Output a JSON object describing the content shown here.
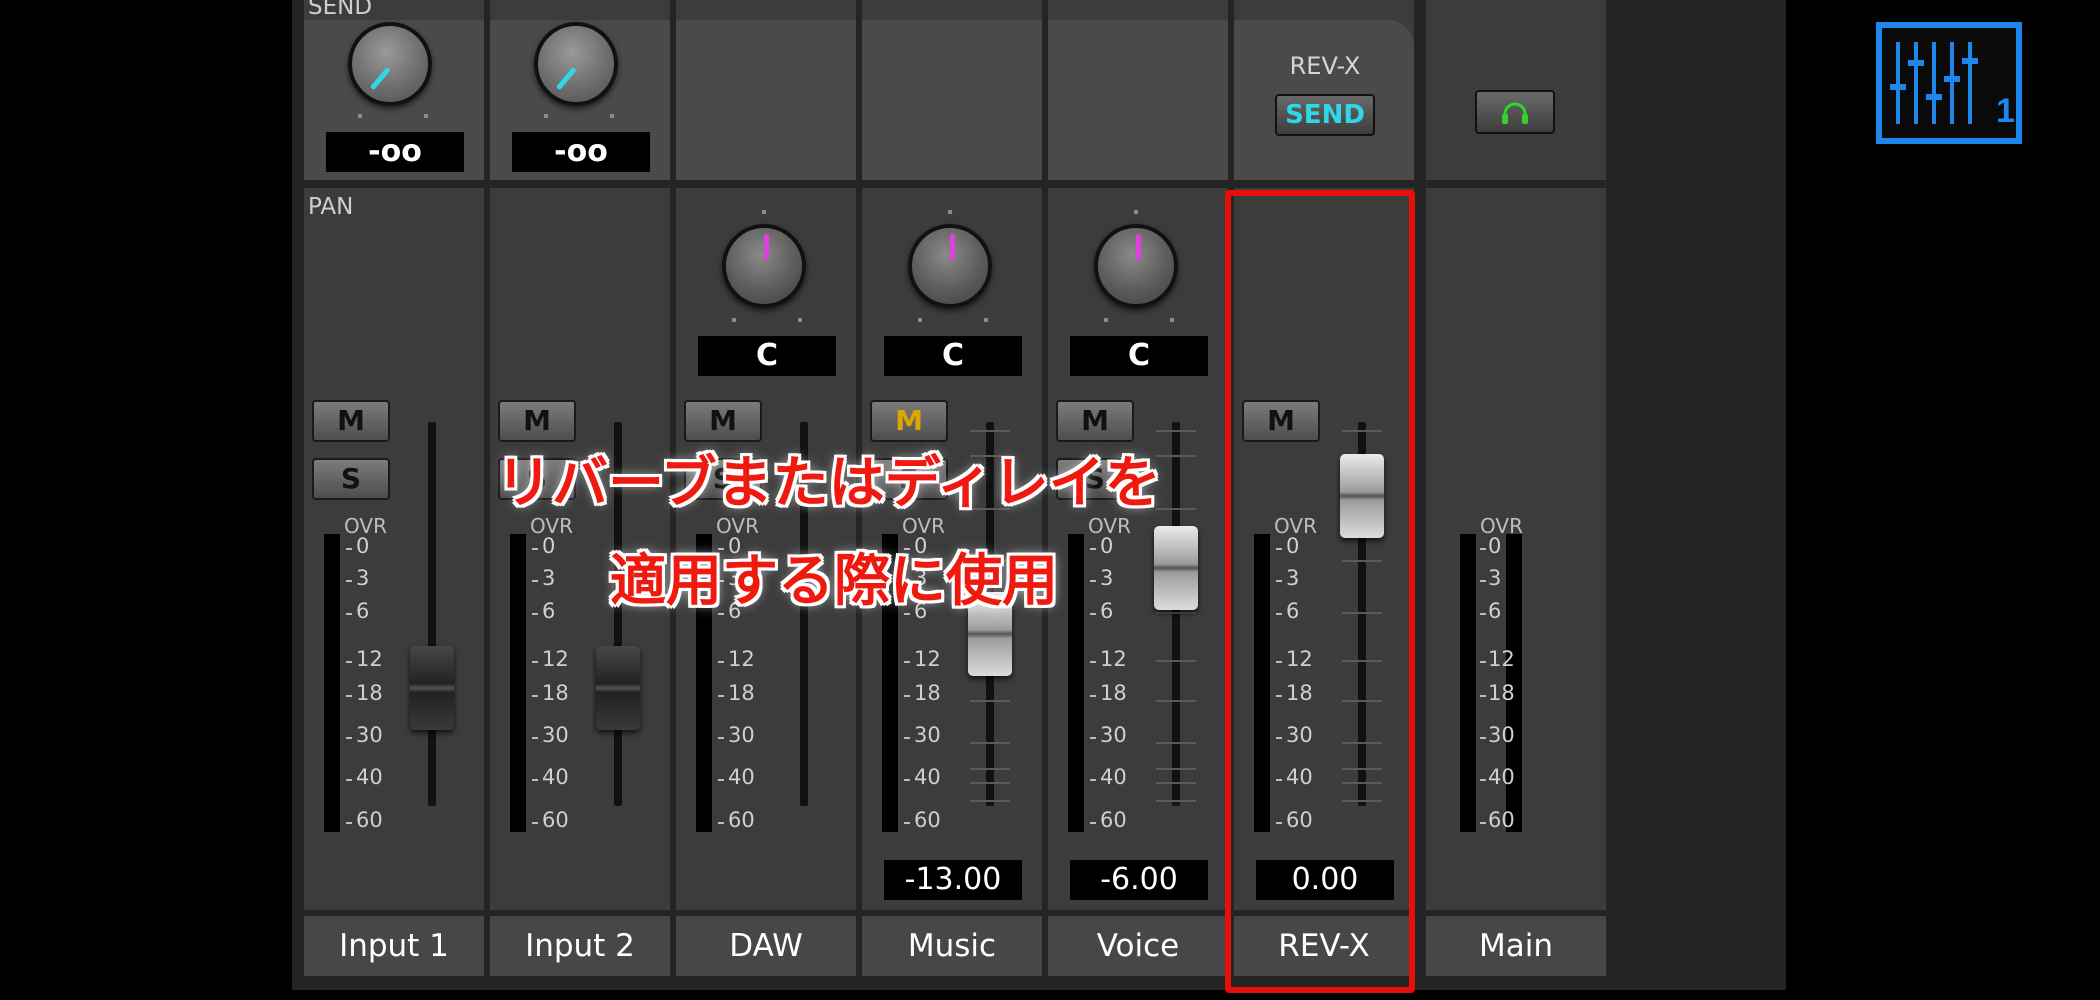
{
  "sections": {
    "send_label": "SEND",
    "pan_label": "PAN"
  },
  "send_values": [
    "-oo",
    "-oo"
  ],
  "pan_values": [
    "C",
    "C",
    "C"
  ],
  "rev_x": {
    "title": "REV-X",
    "send_label": "SEND"
  },
  "buttons": {
    "mute": "M",
    "solo": "S"
  },
  "meter": {
    "ovr_label": "OVR",
    "scale": [
      "0",
      "3",
      "6",
      "12",
      "18",
      "30",
      "40",
      "60"
    ]
  },
  "fader_values": [
    "-13.00",
    "-6.00",
    "0.00"
  ],
  "channels": [
    "Input 1",
    "Input 2",
    "DAW",
    "Music",
    "Voice",
    "REV-X",
    "Main"
  ],
  "annotation": {
    "line1": "リバーブまたはディレイを",
    "line2": "適用する際に使用"
  },
  "mixer_icon": {
    "page_number": "1"
  },
  "colors": {
    "send_knob": "#2fd8e8",
    "pan_knob": "#e040e0",
    "mute_active": "#e0a400",
    "highlight": "#e4100c",
    "icon": "#1e88ea",
    "headphone": "#32d32c"
  }
}
